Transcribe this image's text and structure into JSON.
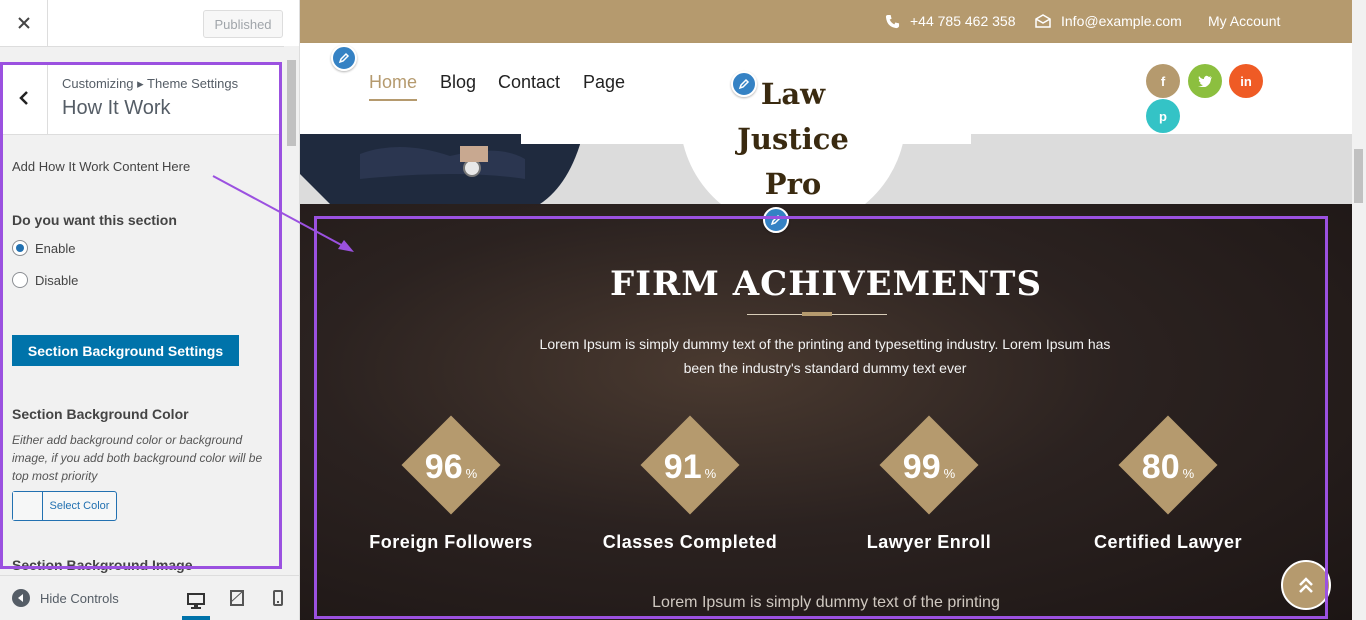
{
  "sidebar": {
    "close_label": "×",
    "published_label": "Published",
    "breadcrumb": "Customizing ▸ Theme Settings",
    "panel_title": "How It Work",
    "add_content_label": "Add How It Work Content Here",
    "section_question": "Do you want this section",
    "options": [
      {
        "label": "Enable",
        "checked": true
      },
      {
        "label": "Disable",
        "checked": false
      }
    ],
    "bg_settings_button": "Section Background Settings",
    "bg_color_label": "Section Background Color",
    "bg_color_desc": "Either add background color or background image, if you add both background color will be top most priority",
    "select_color_label": "Select Color",
    "bg_image_label": "Section Background Image",
    "hide_controls_label": "Hide Controls",
    "accent_color": "#0073aa"
  },
  "preview": {
    "topbar": {
      "phone": "+44 785 462 358",
      "email": "Info@example.com",
      "account": "My Account",
      "color": "#b59a6e"
    },
    "nav": [
      "Home",
      "Blog",
      "Contact",
      "Page"
    ],
    "logo": {
      "line1": "Law",
      "line2": "Justice",
      "line3": "Pro"
    },
    "social": [
      {
        "name": "facebook-icon",
        "glyph": "f",
        "color": "#b59a6e"
      },
      {
        "name": "twitter-icon",
        "glyph": "t",
        "color": "#8cbf3f"
      },
      {
        "name": "linkedin-icon",
        "glyph": "in",
        "color": "#ef5b25"
      },
      {
        "name": "pinterest-icon",
        "glyph": "p",
        "color": "#34c3c6"
      }
    ],
    "achievements": {
      "title": "FIRM ACHIVEMENTS",
      "desc": "Lorem Ipsum is simply dummy text of the printing and typesetting industry. Lorem Ipsum has been the industry's standard dummy text ever",
      "stats": [
        {
          "value": "96",
          "unit": "%",
          "label": "Foreign Followers"
        },
        {
          "value": "91",
          "unit": "%",
          "label": "Classes Completed"
        },
        {
          "value": "99",
          "unit": "%",
          "label": "Lawyer Enroll"
        },
        {
          "value": "80",
          "unit": "%",
          "label": "Certified Lawyer"
        }
      ],
      "bottom_text": "Lorem Ipsum is simply dummy text of the printing"
    },
    "highlight_color": "#9b51e0"
  }
}
